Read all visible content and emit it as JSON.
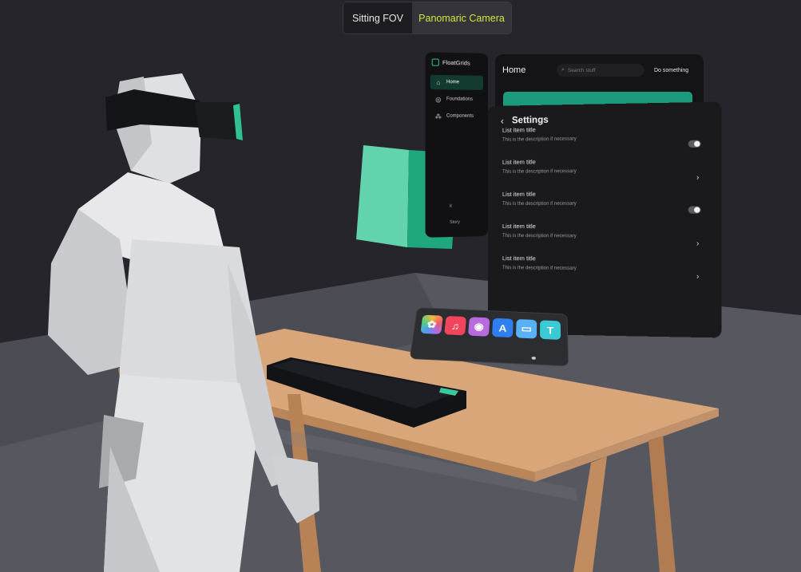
{
  "camera_switch": {
    "options": [
      "Sitting FOV",
      "Panomaric Camera"
    ],
    "selected": "Panomaric Camera"
  },
  "sidebar": {
    "brand": "FloatGrids",
    "items": [
      {
        "icon": "home-icon",
        "label": "Home",
        "active": true
      },
      {
        "icon": "foundations-icon",
        "label": "Foundations",
        "active": false
      },
      {
        "icon": "components-icon",
        "label": "Components",
        "active": false
      }
    ],
    "bottom_items": [
      "it",
      "Story"
    ]
  },
  "home_panel": {
    "title": "Home",
    "search_placeholder": "Search stuff",
    "action_label": "Do something"
  },
  "settings_panel": {
    "title": "Settings",
    "rows": [
      {
        "title": "List item title",
        "description": "This is the description if necessary",
        "control": "toggle"
      },
      {
        "title": "List item title",
        "description": "This is the description if necessary",
        "control": "chevron"
      },
      {
        "title": "List item title",
        "description": "This is the description if necessary",
        "control": "toggle"
      },
      {
        "title": "List item title",
        "description": "This is the description if necessary",
        "control": "chevron"
      },
      {
        "title": "List item title",
        "description": "This is the description if necessary",
        "control": "chevron"
      }
    ]
  },
  "dock": {
    "apps": [
      {
        "name": "photos-icon",
        "color": "#f3d3d8"
      },
      {
        "name": "music-icon",
        "color": "#f0455a"
      },
      {
        "name": "podcasts-icon",
        "color": "#b86adf"
      },
      {
        "name": "app-store-icon",
        "color": "#2f7ff0"
      },
      {
        "name": "files-icon",
        "color": "#5ab0f5"
      },
      {
        "name": "t-app-icon",
        "color": "#3cc9d6"
      }
    ]
  },
  "colors": {
    "accent": "#d4e63a",
    "brand_green": "#1c9a7d",
    "cube_front": "#62d3ad",
    "cube_side": "#1fa77d",
    "background": "#23232a",
    "floor": "#5a5a62",
    "desk": "#d6a57a"
  }
}
